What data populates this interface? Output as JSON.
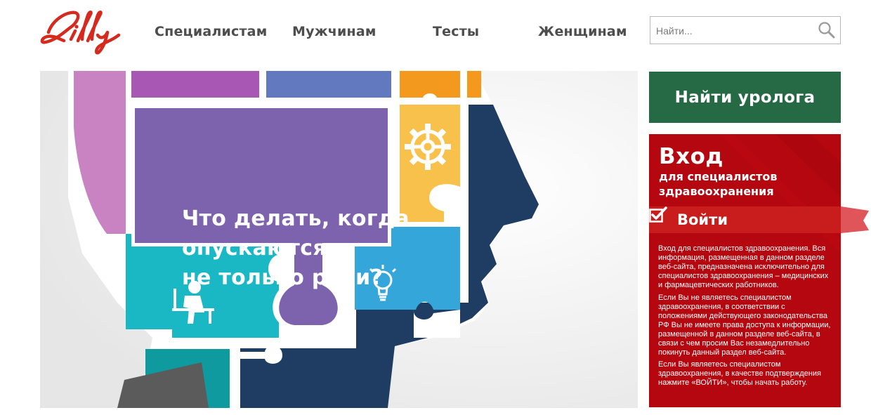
{
  "brand": {
    "logo_text": "Lilly",
    "color": "#d52b1e"
  },
  "nav": {
    "items": [
      {
        "label": "Специалистам"
      },
      {
        "label": "Мужчинам"
      },
      {
        "label": "Тесты"
      },
      {
        "label": "Женщинам"
      }
    ]
  },
  "search": {
    "placeholder": "Найти...",
    "icon": "search-icon"
  },
  "hero": {
    "headline": [
      "Что делать, когда",
      "опускаются",
      "не только руки?"
    ],
    "colors": {
      "purple": "#7d62ad",
      "navy": "#1f3d63",
      "teal": "#19b8c4",
      "orange": "#f39a1e",
      "yellow": "#f8c14b",
      "blue": "#34a6da"
    }
  },
  "find_urologist": {
    "label": "Найти уролога",
    "color": "#256a45"
  },
  "login": {
    "title": "Вход",
    "subtitle": [
      "для специалистов",
      "здравоохранения"
    ],
    "button_label": "Войти",
    "color": "#b5070f",
    "paragraphs": [
      "Вход для специалистов здравоохранения. Вся информация, размещенная в данном разделе веб-сайта, предназначена исключительно для специалистов здравоохранения – медицинских и фармацевтических работников.",
      "Если Вы не являетесь специалистом здравоохранения, в соответствии с положениями действующего законодательства РФ Вы не имеете права доступа к информации, размещенной в данном разделе веб-сайта, в связи с чем просим Вас незамедлительно покинуть данный раздел веб-сайта.",
      "Если Вы являетесь специалистом здравоохранения, в качестве подтверждения нажмите «ВОЙТИ», чтобы начать работу."
    ]
  }
}
